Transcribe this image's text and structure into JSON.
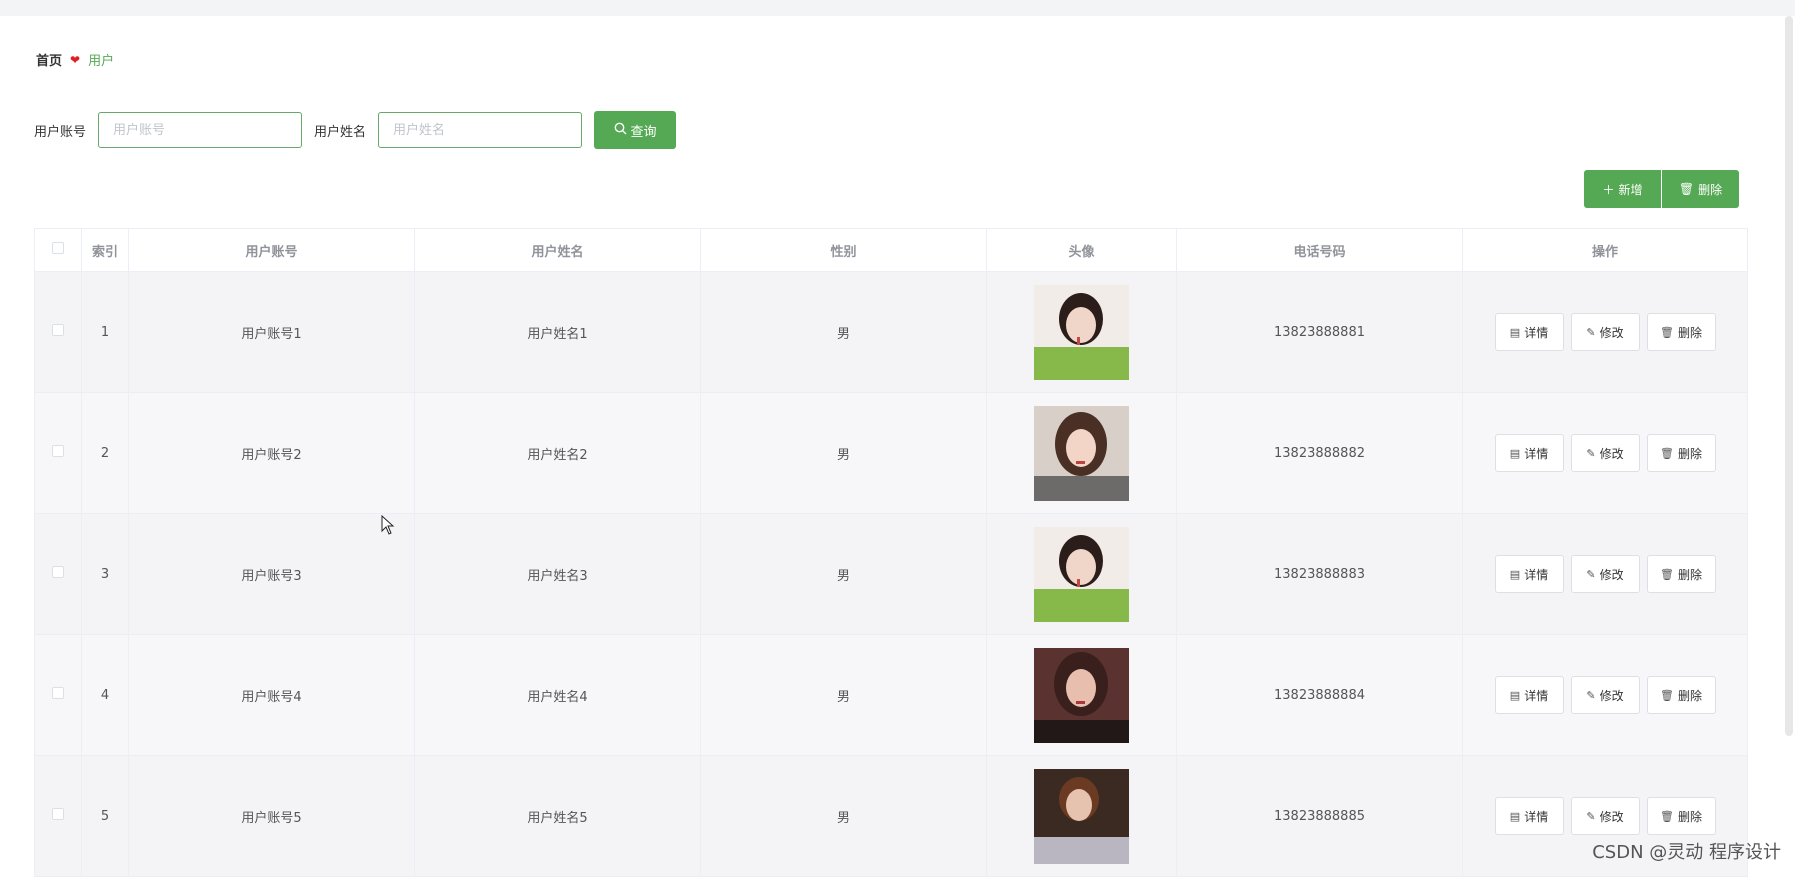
{
  "breadcrumb": {
    "home": "首页",
    "current": "用户"
  },
  "search": {
    "account_label": "用户账号",
    "account_placeholder": "用户账号",
    "account_value": "",
    "name_label": "用户姓名",
    "name_placeholder": "用户姓名",
    "name_value": "",
    "button_label": "查询"
  },
  "actions": {
    "add_label": "新增",
    "delete_label": "删除"
  },
  "table": {
    "headers": {
      "index": "索引",
      "account": "用户账号",
      "name": "用户姓名",
      "gender": "性别",
      "avatar": "头像",
      "phone": "电话号码",
      "ops": "操作"
    },
    "op_labels": {
      "detail": "详情",
      "edit": "修改",
      "delete": "删除"
    },
    "rows": [
      {
        "index": "1",
        "account": "用户账号1",
        "name": "用户姓名1",
        "gender": "男",
        "phone": "13823888881"
      },
      {
        "index": "2",
        "account": "用户账号2",
        "name": "用户姓名2",
        "gender": "男",
        "phone": "13823888882"
      },
      {
        "index": "3",
        "account": "用户账号3",
        "name": "用户姓名3",
        "gender": "男",
        "phone": "13823888883"
      },
      {
        "index": "4",
        "account": "用户账号4",
        "name": "用户姓名4",
        "gender": "男",
        "phone": "13823888884"
      },
      {
        "index": "5",
        "account": "用户账号5",
        "name": "用户姓名5",
        "gender": "男",
        "phone": "13823888885"
      }
    ]
  },
  "watermark": "CSDN @灵动 程序设计",
  "colors": {
    "accent": "#55a854",
    "breadcrumb_separator": "#e02020"
  }
}
